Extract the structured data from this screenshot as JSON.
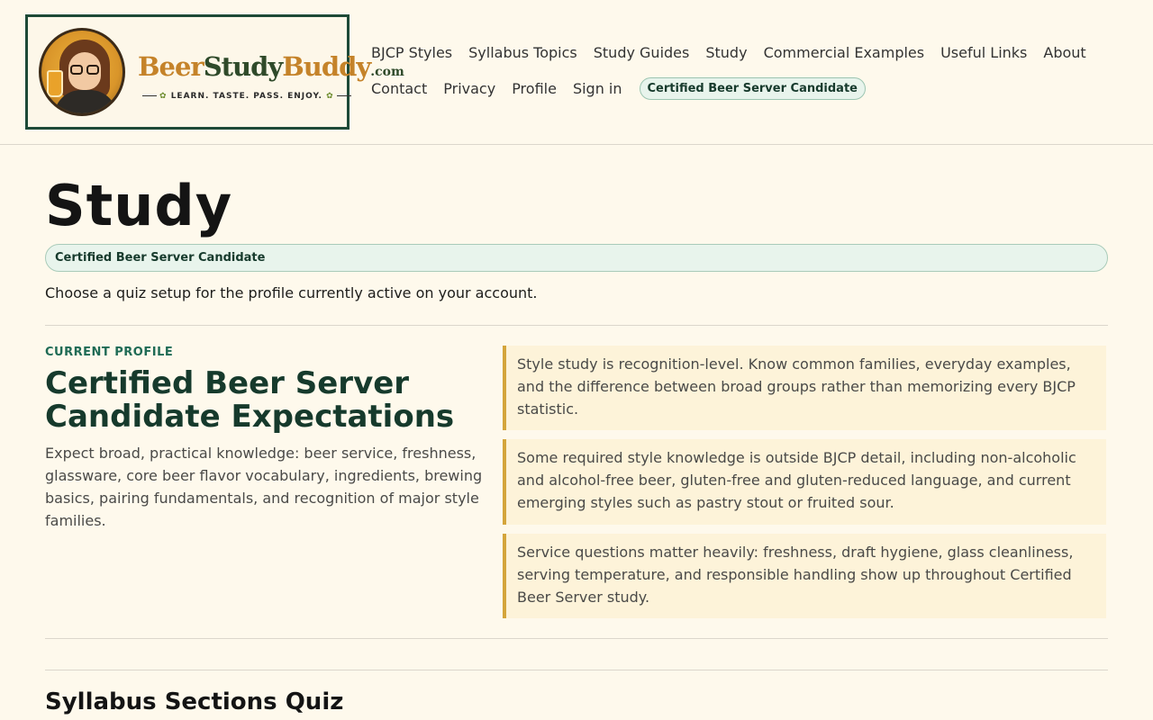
{
  "logo": {
    "word1": "Beer",
    "word2": "Study",
    "word3": "Buddy",
    "domain": ".com",
    "tagline": "LEARN. TASTE. PASS. ENJOY."
  },
  "nav": {
    "row1": [
      "BJCP Styles",
      "Syllabus Topics",
      "Study Guides",
      "Study",
      "Commercial Examples",
      "Useful Links",
      "About"
    ],
    "row2": [
      "Contact",
      "Privacy",
      "Profile",
      "Sign in"
    ],
    "profile_pill": "Certified Beer Server Candidate"
  },
  "main": {
    "title": "Study",
    "profile_banner": "Certified Beer Server Candidate",
    "intro": "Choose a quiz setup for the profile currently active on your account.",
    "eyebrow": "CURRENT PROFILE",
    "expect_title": "Certified Beer Server Candidate Expectations",
    "expect_desc": "Expect broad, practical knowledge: beer service, freshness, glassware, core beer flavor vocabulary, ingredients, brewing basics, pairing fundamentals, and recognition of major style families.",
    "notes": [
      "Style study is recognition-level. Know common families, everyday examples, and the difference between broad groups rather than memorizing every BJCP statistic.",
      "Some required style knowledge is outside BJCP detail, including non-alcoholic and alcohol-free beer, gluten-free and gluten-reduced language, and current emerging styles such as pastry stout or fruited sour.",
      "Service questions matter heavily: freshness, draft hygiene, glass cleanliness, serving temperature, and responsible handling show up throughout Certified Beer Server study."
    ],
    "section_title": "Syllabus Sections Quiz"
  },
  "colors": {
    "background": "#fef9ec",
    "accent_green": "#163a2c",
    "accent_gold": "#d4a53b"
  }
}
